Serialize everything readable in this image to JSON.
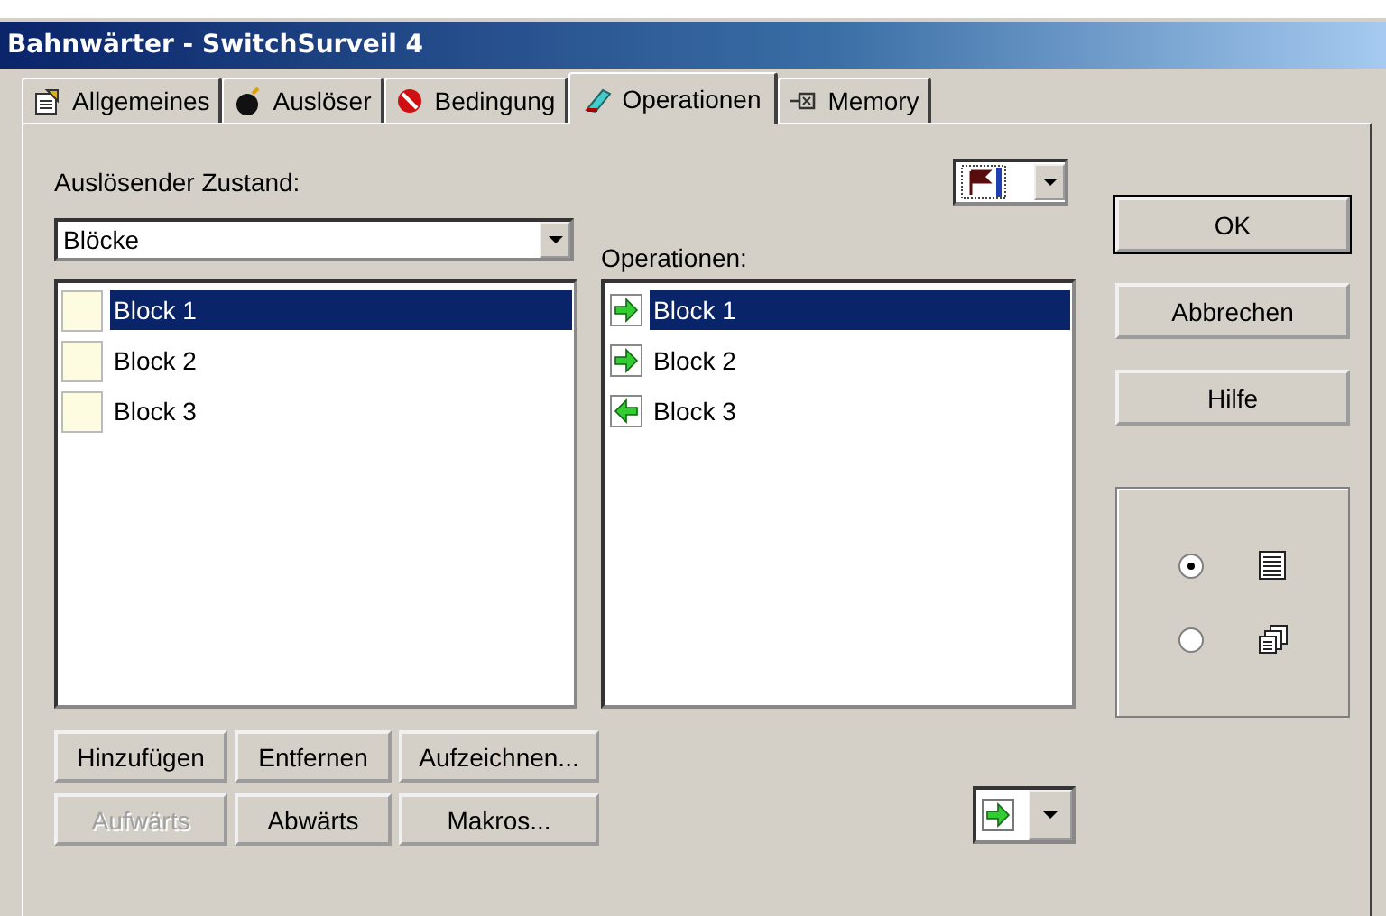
{
  "window": {
    "title": "Bahnwärter - SwitchSurveil 4"
  },
  "tabs": [
    {
      "label": "Allgemeines",
      "kind": "general",
      "selected": false
    },
    {
      "label": "Auslöser",
      "kind": "trigger",
      "selected": false
    },
    {
      "label": "Bedingung",
      "kind": "condition",
      "selected": false
    },
    {
      "label": "Operationen",
      "kind": "operations",
      "selected": true
    },
    {
      "label": "Memory",
      "kind": "memory",
      "selected": false
    }
  ],
  "trigger_state": {
    "label": "Auslösender Zustand:"
  },
  "source_combo": {
    "value": "Blöcke"
  },
  "blocks": [
    {
      "label": "Block 1",
      "color": "#fdfbe0",
      "selected": true
    },
    {
      "label": "Block 2",
      "color": "#fdfbe0",
      "selected": false
    },
    {
      "label": "Block 3",
      "color": "#fdfbe0",
      "selected": false
    }
  ],
  "operations_label": "Operationen:",
  "operations": [
    {
      "label": "Block 1",
      "kind": "forward",
      "selected": true
    },
    {
      "label": "Block 2",
      "kind": "forward",
      "selected": false
    },
    {
      "label": "Block 3",
      "kind": "backward",
      "selected": false
    }
  ],
  "list_buttons": [
    {
      "label": "Hinzufügen",
      "disabled": false
    },
    {
      "label": "Entfernen",
      "disabled": false
    },
    {
      "label": "Aufzeichnen...",
      "disabled": false
    },
    {
      "label": "Aufwärts",
      "disabled": true
    },
    {
      "label": "Abwärts",
      "disabled": false
    },
    {
      "label": "Makros...",
      "disabled": false
    }
  ],
  "dialog_buttons": [
    {
      "label": "OK",
      "default": true
    },
    {
      "label": "Abbrechen",
      "default": false
    },
    {
      "label": "Hilfe",
      "default": false
    }
  ],
  "view_options": [
    {
      "kind": "list",
      "selected": true
    },
    {
      "kind": "pages",
      "selected": false
    }
  ]
}
